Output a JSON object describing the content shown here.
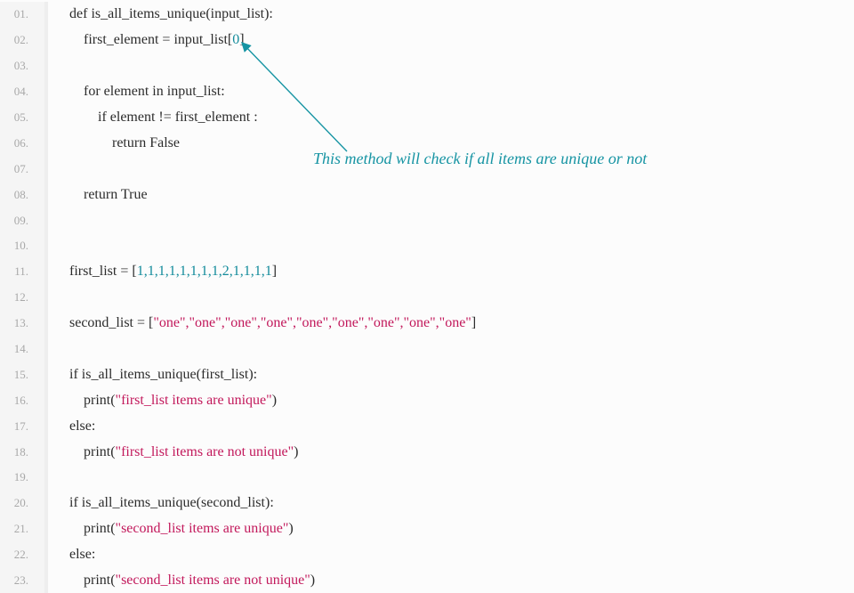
{
  "annotation": {
    "text": "This method will check if all items are unique or not",
    "color": "#1694a3"
  },
  "linenos": [
    "01.",
    "02.",
    "03.",
    "04.",
    "05.",
    "06.",
    "07.",
    "08.",
    "09.",
    "10.",
    "11.",
    "12.",
    "13.",
    "14.",
    "15.",
    "16.",
    "17.",
    "18.",
    "19.",
    "20.",
    "21.",
    "22.",
    "23."
  ],
  "code": {
    "l1": {
      "kw_def": "def ",
      "fn": "is_all_items_unique",
      "open": "(",
      "arg": "input_list",
      "close": "):"
    },
    "l2": {
      "indent": "    ",
      "var": "first_element",
      "eq": " = ",
      "src": "input_list",
      "lb": "[",
      "idx": "0",
      "rb": "]"
    },
    "l3": {
      "blank": " "
    },
    "l4": {
      "indent": "    ",
      "kw_for": "for ",
      "var": "element",
      "kw_in": " in ",
      "src": "input_list",
      "colon": ":"
    },
    "l5": {
      "indent": "        ",
      "kw_if": "if ",
      "lhs": "element",
      "ne": " != ",
      "rhs": "first_element ",
      "colon": ":"
    },
    "l6": {
      "indent": "            ",
      "kw_return": "return ",
      "val": "False"
    },
    "l7": {
      "blank": " "
    },
    "l8": {
      "indent": "    ",
      "kw_return": "return ",
      "val": "True"
    },
    "l9": {
      "blank": " "
    },
    "l10": {
      "blank": " "
    },
    "l11": {
      "var": "first_list",
      "eq": " = ",
      "lb": "[",
      "nums": "1,1,1,1,1,1,1,1,2,1,1,1,1",
      "rb": "]"
    },
    "l12": {
      "blank": " "
    },
    "l13": {
      "var": "second_list",
      "eq": " = ",
      "lb": "[",
      "strs": "\"one\",\"one\",\"one\",\"one\",\"one\",\"one\",\"one\",\"one\",\"one\"",
      "rb": "]"
    },
    "l14": {
      "blank": " "
    },
    "l15": {
      "kw_if": "if ",
      "fn": "is_all_items_unique",
      "open": "(",
      "arg": "first_list",
      "close": "):"
    },
    "l16": {
      "indent": "    ",
      "fn": "print",
      "open": "(",
      "str": "\"first_list items are unique\"",
      "close": ")"
    },
    "l17": {
      "kw_else": "else:"
    },
    "l18": {
      "indent": "    ",
      "fn": "print",
      "open": "(",
      "str": "\"first_list items are not unique\"",
      "close": ")"
    },
    "l19": {
      "blank": " "
    },
    "l20": {
      "kw_if": "if ",
      "fn": "is_all_items_unique",
      "open": "(",
      "arg": "second_list",
      "close": "):"
    },
    "l21": {
      "indent": "    ",
      "fn": "print",
      "open": "(",
      "str": "\"second_list items are unique\"",
      "close": ")"
    },
    "l22": {
      "kw_else": "else:"
    },
    "l23": {
      "indent": "    ",
      "fn": "print",
      "open": "(",
      "str": "\"second_list items are not unique\"",
      "close": ")"
    }
  }
}
